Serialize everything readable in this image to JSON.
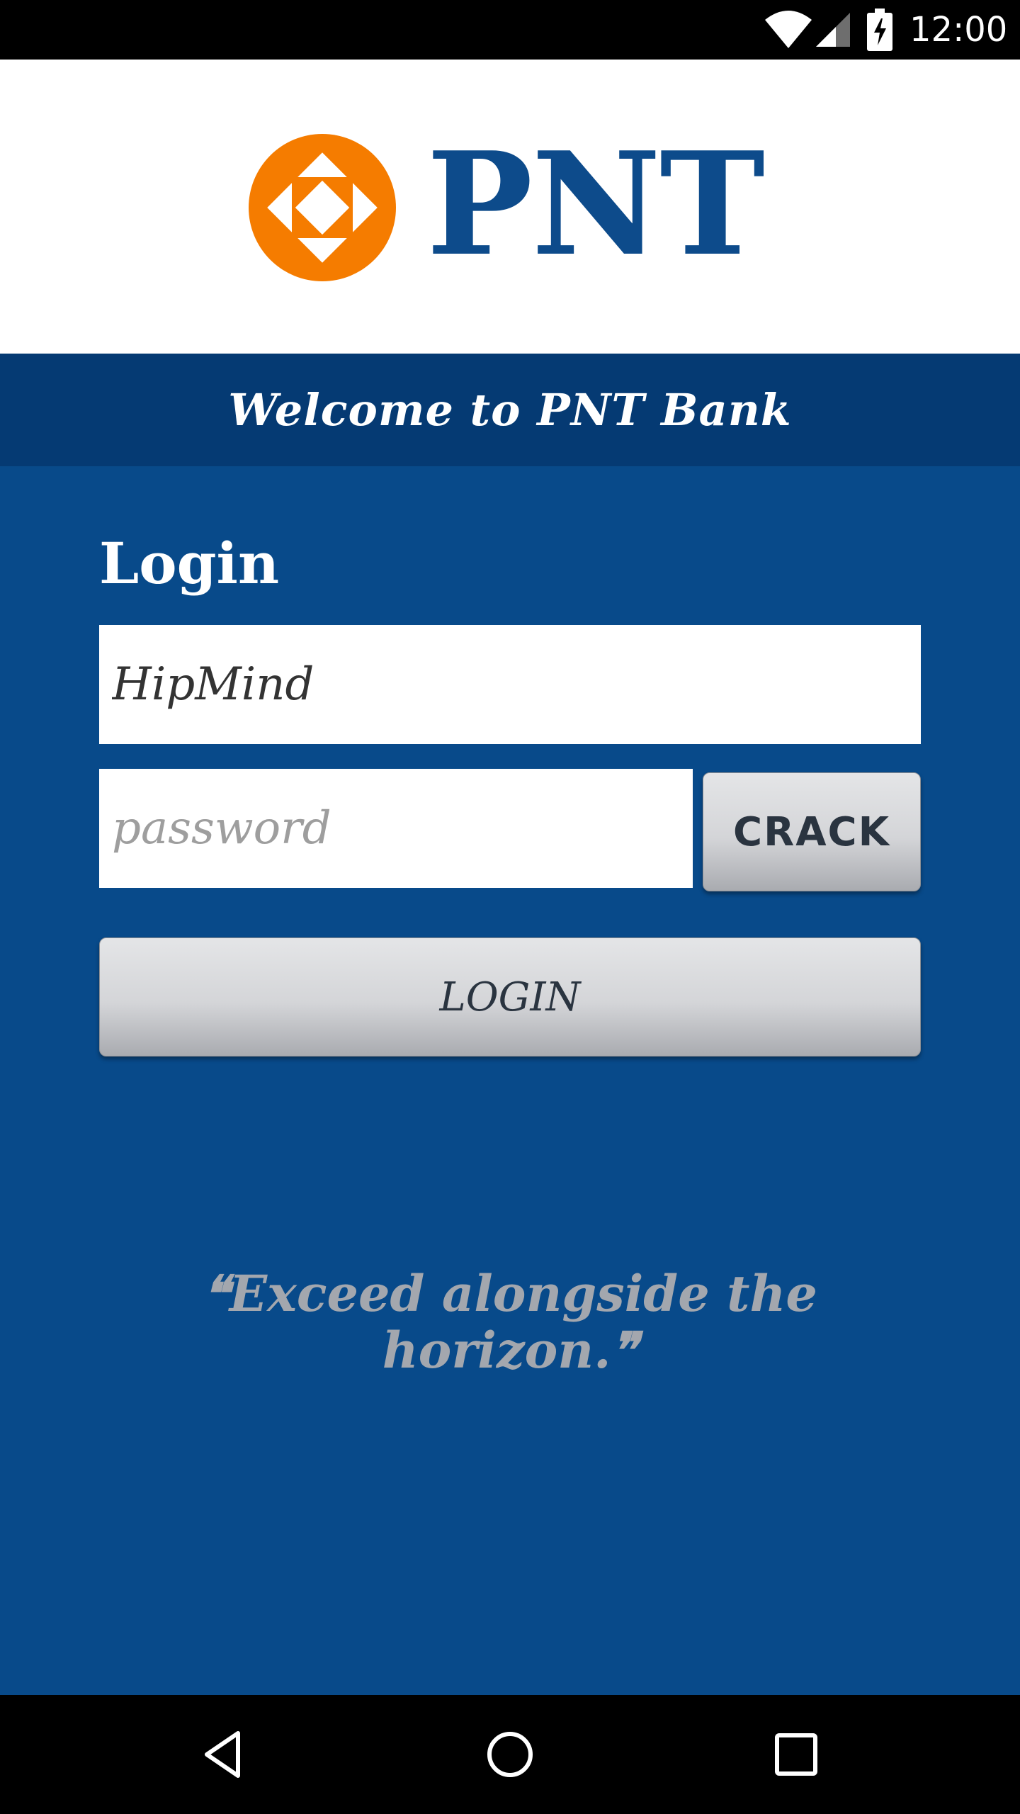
{
  "status_bar": {
    "time": "12:00",
    "icons": [
      "wifi-icon",
      "signal-icon",
      "battery-charging-icon"
    ]
  },
  "header": {
    "logo_text": "PNT",
    "logo_colors": {
      "mark": "#f57c00",
      "text": "#0d4b8b"
    },
    "welcome": "Welcome to PNT Bank"
  },
  "login": {
    "title": "Login",
    "username_value": "HipMind",
    "password_placeholder": "password",
    "crack_label": "CRACK",
    "login_label": "LOGIN"
  },
  "tagline": {
    "open_quote": "❝",
    "text": "Exceed alongside the horizon.",
    "close_quote": "❞"
  },
  "nav_bar": {
    "icons": [
      "back-icon",
      "home-icon",
      "recents-icon"
    ]
  },
  "colors": {
    "background": "#084a8a",
    "band": "#053a73",
    "tagline": "#a3a7ae"
  }
}
